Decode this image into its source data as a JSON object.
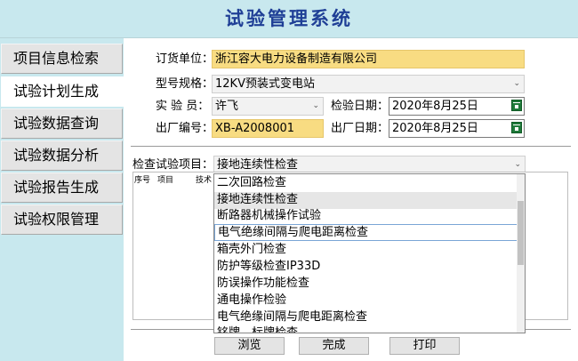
{
  "app": {
    "title": "试验管理系统"
  },
  "sidebar": {
    "items": [
      {
        "label": "项目信息检索",
        "active": false
      },
      {
        "label": "试验计划生成",
        "active": true
      },
      {
        "label": "试验数据查询",
        "active": false
      },
      {
        "label": "试验数据分析",
        "active": false
      },
      {
        "label": "试验报告生成",
        "active": false
      },
      {
        "label": "试验权限管理",
        "active": false
      }
    ]
  },
  "form": {
    "order_unit_label": "订货单位：",
    "order_unit_value": "浙江容大电力设备制造有限公司",
    "model_label": "型号规格：",
    "model_value": "12KV预装式变电站",
    "tester_label": "实 验 员：",
    "tester_value": "许飞",
    "inspect_date_label": "检验日期：",
    "inspect_date_value": "2020年8月25日",
    "serial_label": "出厂编号：",
    "serial_value": "XB-A2008001",
    "factory_date_label": "出厂日期：",
    "factory_date_value": "2020年8月25日"
  },
  "check": {
    "label": "检查试验项目：",
    "selected": "接地连续性检查",
    "grid_headers": [
      "序号",
      "项目",
      "技术"
    ]
  },
  "dropdown": {
    "options": [
      "二次回路检查",
      "接地连续性检查",
      "断路器机械操作试验",
      "电气绝缘间隔与爬电距离检查",
      "箱壳外门检查",
      "防护等级检查IP33D",
      "防误操作功能检查",
      "通电操作检验",
      "电气绝缘间隔与爬电距离检查",
      "铭牌、标牌检查"
    ],
    "selected_index": 1,
    "hover_index": 3
  },
  "buttons": {
    "browse": "浏览",
    "done": "完成",
    "print": "打印"
  },
  "colors": {
    "header_bg": "#c8e8ee",
    "title": "#1f3f96",
    "highlight": "#f8dc82",
    "calendar_icon": "#1f7a3a"
  }
}
